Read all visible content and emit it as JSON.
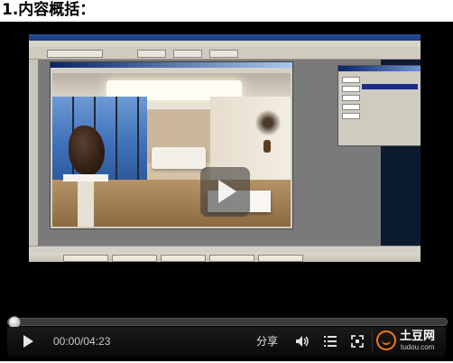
{
  "page": {
    "heading": "1.内容概括："
  },
  "player": {
    "progress": 0.0,
    "time_display": "00:00/04:23",
    "share_label": "分享",
    "logo": {
      "name": "土豆网",
      "url": "tudou.com",
      "color": "#f07a10"
    },
    "icons": [
      "play-icon",
      "volume-icon",
      "playlist-icon",
      "fullscreen-icon",
      "big-play-icon"
    ]
  }
}
